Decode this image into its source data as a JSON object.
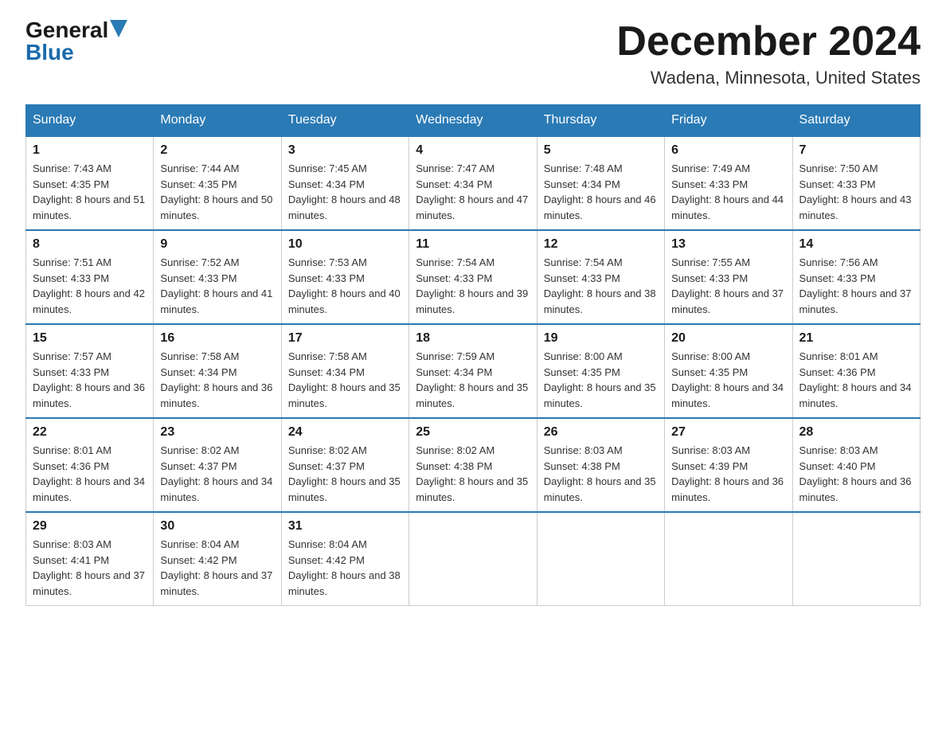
{
  "logo": {
    "general": "General",
    "blue": "Blue",
    "arrow": "▶"
  },
  "title": "December 2024",
  "subtitle": "Wadena, Minnesota, United States",
  "days_of_week": [
    "Sunday",
    "Monday",
    "Tuesday",
    "Wednesday",
    "Thursday",
    "Friday",
    "Saturday"
  ],
  "weeks": [
    [
      {
        "day": "1",
        "sunrise": "7:43 AM",
        "sunset": "4:35 PM",
        "daylight": "8 hours and 51 minutes."
      },
      {
        "day": "2",
        "sunrise": "7:44 AM",
        "sunset": "4:35 PM",
        "daylight": "8 hours and 50 minutes."
      },
      {
        "day": "3",
        "sunrise": "7:45 AM",
        "sunset": "4:34 PM",
        "daylight": "8 hours and 48 minutes."
      },
      {
        "day": "4",
        "sunrise": "7:47 AM",
        "sunset": "4:34 PM",
        "daylight": "8 hours and 47 minutes."
      },
      {
        "day": "5",
        "sunrise": "7:48 AM",
        "sunset": "4:34 PM",
        "daylight": "8 hours and 46 minutes."
      },
      {
        "day": "6",
        "sunrise": "7:49 AM",
        "sunset": "4:33 PM",
        "daylight": "8 hours and 44 minutes."
      },
      {
        "day": "7",
        "sunrise": "7:50 AM",
        "sunset": "4:33 PM",
        "daylight": "8 hours and 43 minutes."
      }
    ],
    [
      {
        "day": "8",
        "sunrise": "7:51 AM",
        "sunset": "4:33 PM",
        "daylight": "8 hours and 42 minutes."
      },
      {
        "day": "9",
        "sunrise": "7:52 AM",
        "sunset": "4:33 PM",
        "daylight": "8 hours and 41 minutes."
      },
      {
        "day": "10",
        "sunrise": "7:53 AM",
        "sunset": "4:33 PM",
        "daylight": "8 hours and 40 minutes."
      },
      {
        "day": "11",
        "sunrise": "7:54 AM",
        "sunset": "4:33 PM",
        "daylight": "8 hours and 39 minutes."
      },
      {
        "day": "12",
        "sunrise": "7:54 AM",
        "sunset": "4:33 PM",
        "daylight": "8 hours and 38 minutes."
      },
      {
        "day": "13",
        "sunrise": "7:55 AM",
        "sunset": "4:33 PM",
        "daylight": "8 hours and 37 minutes."
      },
      {
        "day": "14",
        "sunrise": "7:56 AM",
        "sunset": "4:33 PM",
        "daylight": "8 hours and 37 minutes."
      }
    ],
    [
      {
        "day": "15",
        "sunrise": "7:57 AM",
        "sunset": "4:33 PM",
        "daylight": "8 hours and 36 minutes."
      },
      {
        "day": "16",
        "sunrise": "7:58 AM",
        "sunset": "4:34 PM",
        "daylight": "8 hours and 36 minutes."
      },
      {
        "day": "17",
        "sunrise": "7:58 AM",
        "sunset": "4:34 PM",
        "daylight": "8 hours and 35 minutes."
      },
      {
        "day": "18",
        "sunrise": "7:59 AM",
        "sunset": "4:34 PM",
        "daylight": "8 hours and 35 minutes."
      },
      {
        "day": "19",
        "sunrise": "8:00 AM",
        "sunset": "4:35 PM",
        "daylight": "8 hours and 35 minutes."
      },
      {
        "day": "20",
        "sunrise": "8:00 AM",
        "sunset": "4:35 PM",
        "daylight": "8 hours and 34 minutes."
      },
      {
        "day": "21",
        "sunrise": "8:01 AM",
        "sunset": "4:36 PM",
        "daylight": "8 hours and 34 minutes."
      }
    ],
    [
      {
        "day": "22",
        "sunrise": "8:01 AM",
        "sunset": "4:36 PM",
        "daylight": "8 hours and 34 minutes."
      },
      {
        "day": "23",
        "sunrise": "8:02 AM",
        "sunset": "4:37 PM",
        "daylight": "8 hours and 34 minutes."
      },
      {
        "day": "24",
        "sunrise": "8:02 AM",
        "sunset": "4:37 PM",
        "daylight": "8 hours and 35 minutes."
      },
      {
        "day": "25",
        "sunrise": "8:02 AM",
        "sunset": "4:38 PM",
        "daylight": "8 hours and 35 minutes."
      },
      {
        "day": "26",
        "sunrise": "8:03 AM",
        "sunset": "4:38 PM",
        "daylight": "8 hours and 35 minutes."
      },
      {
        "day": "27",
        "sunrise": "8:03 AM",
        "sunset": "4:39 PM",
        "daylight": "8 hours and 36 minutes."
      },
      {
        "day": "28",
        "sunrise": "8:03 AM",
        "sunset": "4:40 PM",
        "daylight": "8 hours and 36 minutes."
      }
    ],
    [
      {
        "day": "29",
        "sunrise": "8:03 AM",
        "sunset": "4:41 PM",
        "daylight": "8 hours and 37 minutes."
      },
      {
        "day": "30",
        "sunrise": "8:04 AM",
        "sunset": "4:42 PM",
        "daylight": "8 hours and 37 minutes."
      },
      {
        "day": "31",
        "sunrise": "8:04 AM",
        "sunset": "4:42 PM",
        "daylight": "8 hours and 38 minutes."
      },
      null,
      null,
      null,
      null
    ]
  ]
}
